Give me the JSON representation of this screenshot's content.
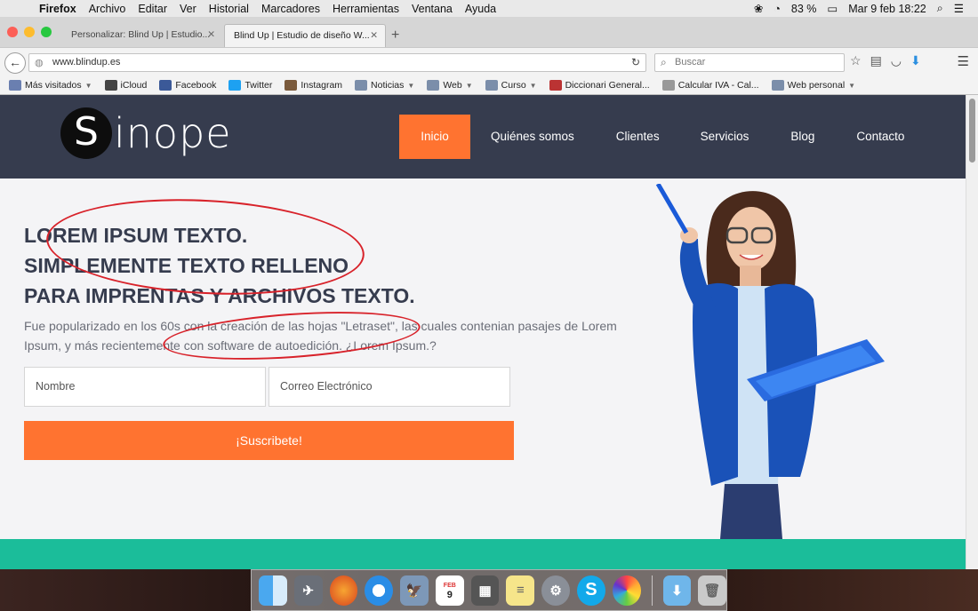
{
  "menubar": {
    "app": "Firefox",
    "items": [
      "Archivo",
      "Editar",
      "Ver",
      "Historial",
      "Marcadores",
      "Herramientas",
      "Ventana",
      "Ayuda"
    ],
    "battery": "83 %",
    "datetime": "Mar 9 feb  18:22"
  },
  "browser": {
    "tabs": [
      {
        "label": "Personalizar: Blind Up | Estudio..."
      },
      {
        "label": "Blind Up | Estudio de diseño W..."
      }
    ],
    "url": "www.blindup.es",
    "search_placeholder": "Buscar",
    "bookmarks": [
      {
        "label": "Más visitados",
        "color": "#6a7fb0",
        "dropdown": true
      },
      {
        "label": "iCloud",
        "color": "#444",
        "dropdown": false
      },
      {
        "label": "Facebook",
        "color": "#3b5998",
        "dropdown": false
      },
      {
        "label": "Twitter",
        "color": "#1da1f2",
        "dropdown": false
      },
      {
        "label": "Instagram",
        "color": "#7a5a3c",
        "dropdown": false
      },
      {
        "label": "Noticias",
        "color": "#7b8eaa",
        "dropdown": true
      },
      {
        "label": "Web",
        "color": "#7b8eaa",
        "dropdown": true
      },
      {
        "label": "Curso",
        "color": "#7b8eaa",
        "dropdown": true
      },
      {
        "label": "Diccionari General...",
        "color": "#b33",
        "dropdown": false
      },
      {
        "label": "Calcular IVA - Cal...",
        "color": "#999",
        "dropdown": false
      },
      {
        "label": "Web personal",
        "color": "#7b8eaa",
        "dropdown": true
      }
    ]
  },
  "site": {
    "logo_letter": "S",
    "logo_word": "inope",
    "nav": [
      "Inicio",
      "Quiénes somos",
      "Clientes",
      "Servicios",
      "Blog",
      "Contacto"
    ],
    "hero_lines": [
      "LOREM IPSUM TEXTO.",
      "SIMPLEMENTE TEXTO RELLENO",
      "PARA IMPRENTAS Y ARCHIVOS TEXTO."
    ],
    "hero_text": "Fue popularizado en los 60s con la creación de las hojas \"Letraset\", las cuales contenian pasajes de Lorem Ipsum, y más recientemente con software de autoedición. ¿Lorem Ipsum.?",
    "name_placeholder": "Nombre",
    "email_placeholder": "Correo Electrónico",
    "cta": "¡Suscribete!"
  },
  "colors": {
    "header": "#363c4e",
    "accent": "#ff7330",
    "teal": "#1bbd9a",
    "annotation": "#d8222a"
  },
  "dock": {
    "calendar_month": "FEB",
    "calendar_day": "9",
    "icons": [
      "finder-icon",
      "launchpad-icon",
      "firefox-icon",
      "safari-icon",
      "preview-icon",
      "calendar-icon",
      "calculator-icon",
      "notes-icon",
      "system-preferences-icon",
      "skype-icon",
      "photos-icon",
      "downloads-folder-icon",
      "trash-icon"
    ]
  }
}
